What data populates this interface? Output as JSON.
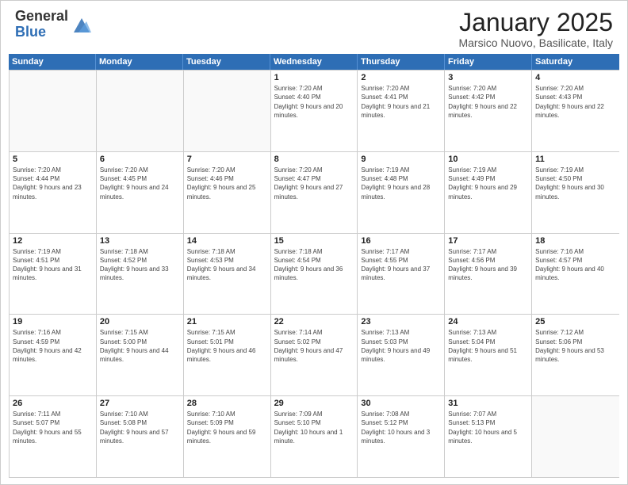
{
  "header": {
    "logo_general": "General",
    "logo_blue": "Blue",
    "month_title": "January 2025",
    "location": "Marsico Nuovo, Basilicate, Italy"
  },
  "weekdays": [
    "Sunday",
    "Monday",
    "Tuesday",
    "Wednesday",
    "Thursday",
    "Friday",
    "Saturday"
  ],
  "weeks": [
    [
      {
        "day": "",
        "sunrise": "",
        "sunset": "",
        "daylight": ""
      },
      {
        "day": "",
        "sunrise": "",
        "sunset": "",
        "daylight": ""
      },
      {
        "day": "",
        "sunrise": "",
        "sunset": "",
        "daylight": ""
      },
      {
        "day": "1",
        "sunrise": "Sunrise: 7:20 AM",
        "sunset": "Sunset: 4:40 PM",
        "daylight": "Daylight: 9 hours and 20 minutes."
      },
      {
        "day": "2",
        "sunrise": "Sunrise: 7:20 AM",
        "sunset": "Sunset: 4:41 PM",
        "daylight": "Daylight: 9 hours and 21 minutes."
      },
      {
        "day": "3",
        "sunrise": "Sunrise: 7:20 AM",
        "sunset": "Sunset: 4:42 PM",
        "daylight": "Daylight: 9 hours and 22 minutes."
      },
      {
        "day": "4",
        "sunrise": "Sunrise: 7:20 AM",
        "sunset": "Sunset: 4:43 PM",
        "daylight": "Daylight: 9 hours and 22 minutes."
      }
    ],
    [
      {
        "day": "5",
        "sunrise": "Sunrise: 7:20 AM",
        "sunset": "Sunset: 4:44 PM",
        "daylight": "Daylight: 9 hours and 23 minutes."
      },
      {
        "day": "6",
        "sunrise": "Sunrise: 7:20 AM",
        "sunset": "Sunset: 4:45 PM",
        "daylight": "Daylight: 9 hours and 24 minutes."
      },
      {
        "day": "7",
        "sunrise": "Sunrise: 7:20 AM",
        "sunset": "Sunset: 4:46 PM",
        "daylight": "Daylight: 9 hours and 25 minutes."
      },
      {
        "day": "8",
        "sunrise": "Sunrise: 7:20 AM",
        "sunset": "Sunset: 4:47 PM",
        "daylight": "Daylight: 9 hours and 27 minutes."
      },
      {
        "day": "9",
        "sunrise": "Sunrise: 7:19 AM",
        "sunset": "Sunset: 4:48 PM",
        "daylight": "Daylight: 9 hours and 28 minutes."
      },
      {
        "day": "10",
        "sunrise": "Sunrise: 7:19 AM",
        "sunset": "Sunset: 4:49 PM",
        "daylight": "Daylight: 9 hours and 29 minutes."
      },
      {
        "day": "11",
        "sunrise": "Sunrise: 7:19 AM",
        "sunset": "Sunset: 4:50 PM",
        "daylight": "Daylight: 9 hours and 30 minutes."
      }
    ],
    [
      {
        "day": "12",
        "sunrise": "Sunrise: 7:19 AM",
        "sunset": "Sunset: 4:51 PM",
        "daylight": "Daylight: 9 hours and 31 minutes."
      },
      {
        "day": "13",
        "sunrise": "Sunrise: 7:18 AM",
        "sunset": "Sunset: 4:52 PM",
        "daylight": "Daylight: 9 hours and 33 minutes."
      },
      {
        "day": "14",
        "sunrise": "Sunrise: 7:18 AM",
        "sunset": "Sunset: 4:53 PM",
        "daylight": "Daylight: 9 hours and 34 minutes."
      },
      {
        "day": "15",
        "sunrise": "Sunrise: 7:18 AM",
        "sunset": "Sunset: 4:54 PM",
        "daylight": "Daylight: 9 hours and 36 minutes."
      },
      {
        "day": "16",
        "sunrise": "Sunrise: 7:17 AM",
        "sunset": "Sunset: 4:55 PM",
        "daylight": "Daylight: 9 hours and 37 minutes."
      },
      {
        "day": "17",
        "sunrise": "Sunrise: 7:17 AM",
        "sunset": "Sunset: 4:56 PM",
        "daylight": "Daylight: 9 hours and 39 minutes."
      },
      {
        "day": "18",
        "sunrise": "Sunrise: 7:16 AM",
        "sunset": "Sunset: 4:57 PM",
        "daylight": "Daylight: 9 hours and 40 minutes."
      }
    ],
    [
      {
        "day": "19",
        "sunrise": "Sunrise: 7:16 AM",
        "sunset": "Sunset: 4:59 PM",
        "daylight": "Daylight: 9 hours and 42 minutes."
      },
      {
        "day": "20",
        "sunrise": "Sunrise: 7:15 AM",
        "sunset": "Sunset: 5:00 PM",
        "daylight": "Daylight: 9 hours and 44 minutes."
      },
      {
        "day": "21",
        "sunrise": "Sunrise: 7:15 AM",
        "sunset": "Sunset: 5:01 PM",
        "daylight": "Daylight: 9 hours and 46 minutes."
      },
      {
        "day": "22",
        "sunrise": "Sunrise: 7:14 AM",
        "sunset": "Sunset: 5:02 PM",
        "daylight": "Daylight: 9 hours and 47 minutes."
      },
      {
        "day": "23",
        "sunrise": "Sunrise: 7:13 AM",
        "sunset": "Sunset: 5:03 PM",
        "daylight": "Daylight: 9 hours and 49 minutes."
      },
      {
        "day": "24",
        "sunrise": "Sunrise: 7:13 AM",
        "sunset": "Sunset: 5:04 PM",
        "daylight": "Daylight: 9 hours and 51 minutes."
      },
      {
        "day": "25",
        "sunrise": "Sunrise: 7:12 AM",
        "sunset": "Sunset: 5:06 PM",
        "daylight": "Daylight: 9 hours and 53 minutes."
      }
    ],
    [
      {
        "day": "26",
        "sunrise": "Sunrise: 7:11 AM",
        "sunset": "Sunset: 5:07 PM",
        "daylight": "Daylight: 9 hours and 55 minutes."
      },
      {
        "day": "27",
        "sunrise": "Sunrise: 7:10 AM",
        "sunset": "Sunset: 5:08 PM",
        "daylight": "Daylight: 9 hours and 57 minutes."
      },
      {
        "day": "28",
        "sunrise": "Sunrise: 7:10 AM",
        "sunset": "Sunset: 5:09 PM",
        "daylight": "Daylight: 9 hours and 59 minutes."
      },
      {
        "day": "29",
        "sunrise": "Sunrise: 7:09 AM",
        "sunset": "Sunset: 5:10 PM",
        "daylight": "Daylight: 10 hours and 1 minute."
      },
      {
        "day": "30",
        "sunrise": "Sunrise: 7:08 AM",
        "sunset": "Sunset: 5:12 PM",
        "daylight": "Daylight: 10 hours and 3 minutes."
      },
      {
        "day": "31",
        "sunrise": "Sunrise: 7:07 AM",
        "sunset": "Sunset: 5:13 PM",
        "daylight": "Daylight: 10 hours and 5 minutes."
      },
      {
        "day": "",
        "sunrise": "",
        "sunset": "",
        "daylight": ""
      }
    ]
  ]
}
